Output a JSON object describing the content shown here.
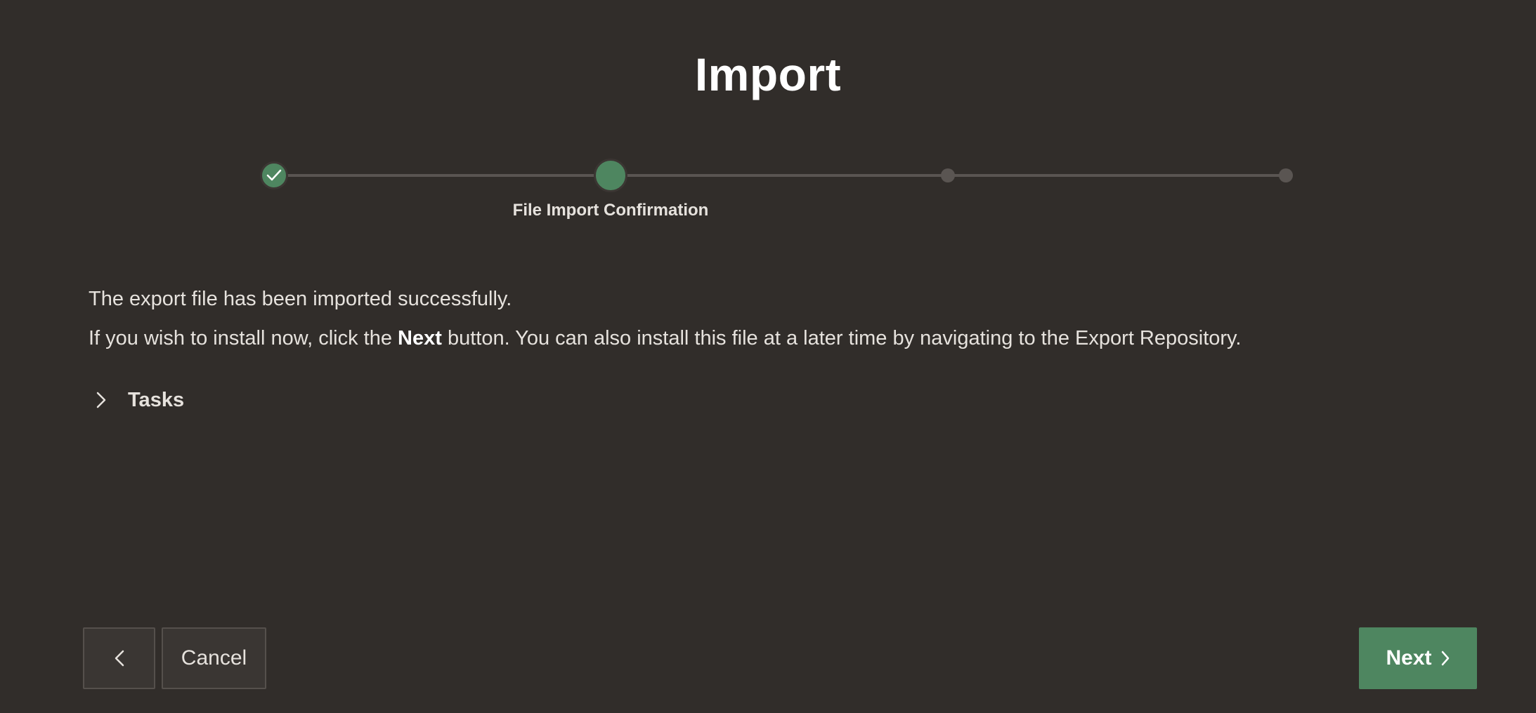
{
  "page": {
    "title": "Import"
  },
  "wizard": {
    "current_step_label": "File Import Confirmation",
    "steps_total": 4,
    "current_step": 2
  },
  "content": {
    "message_line1": "The export file has been imported successfully.",
    "message_line2_before": "If you wish to install now, click the ",
    "message_line2_bold": "Next",
    "message_line2_after": " button. You can also install this file at a later time by navigating to the Export Repository."
  },
  "tasks": {
    "label": "Tasks",
    "expanded": false
  },
  "footer": {
    "cancel_label": "Cancel",
    "next_label": "Next"
  },
  "colors": {
    "background": "#312d2a",
    "accent": "#4e8660",
    "text": "#e6e2dd"
  },
  "icons": {
    "step_done": "check-icon",
    "tasks_toggle": "chevron-right-icon",
    "back": "chevron-left-icon",
    "next": "chevron-right-icon"
  }
}
